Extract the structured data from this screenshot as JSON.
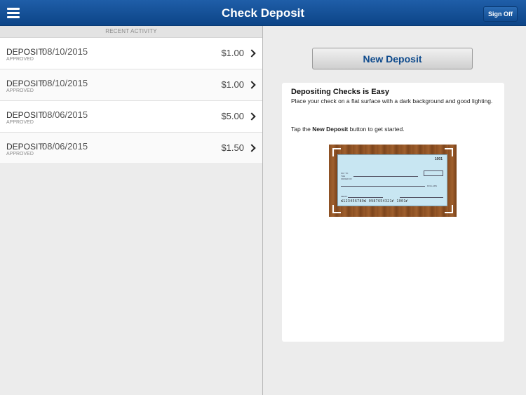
{
  "header": {
    "title": "Check Deposit",
    "menu_icon": "hamburger-menu-icon",
    "sign_off_label": "Sign Off",
    "colors": {
      "bar": "#0c4487",
      "text": "#ffffff"
    }
  },
  "activity": {
    "section_label": "RECENT ACTIVITY",
    "items": [
      {
        "type": "DEPOSIT:",
        "date": "08/10/2015",
        "status": "APPROVED",
        "amount": "$1.00"
      },
      {
        "type": "DEPOSIT:",
        "date": "08/10/2015",
        "status": "APPROVED",
        "amount": "$1.00"
      },
      {
        "type": "DEPOSIT:",
        "date": "08/06/2015",
        "status": "APPROVED",
        "amount": "$5.00"
      },
      {
        "type": "DEPOSIT:",
        "date": "08/06/2015",
        "status": "APPROVED",
        "amount": "$1.50"
      }
    ]
  },
  "main": {
    "new_deposit_label": "New Deposit",
    "info": {
      "title": "Depositing Checks is Easy",
      "body": "Place your check on a flat surface with a dark background and good lighting.",
      "tip_prefix": "Tap the ",
      "tip_bold": "New Deposit",
      "tip_suffix": " button to get started."
    },
    "check_sample": {
      "number": "1001",
      "pay_label": "PAY TO THE ORDER OF",
      "dollars_label": "DOLLARS",
      "memo_label": "MEMO",
      "micr": "⑆123456789⑆ 0987654321⑈ 1001⑈"
    }
  }
}
